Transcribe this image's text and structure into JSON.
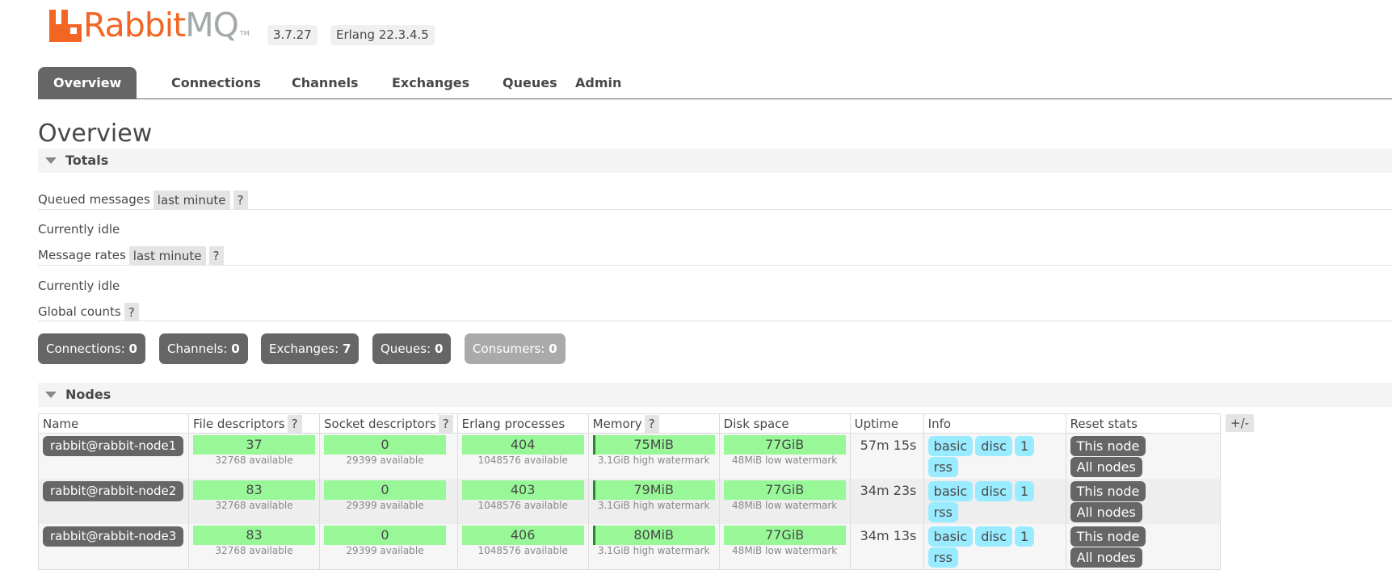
{
  "header": {
    "logo_text_primary": "Rabbit",
    "logo_text_secondary": "MQ",
    "logo_tm": "TM",
    "version": "3.7.27",
    "erlang": "Erlang 22.3.4.5"
  },
  "tabs": [
    {
      "label": "Overview",
      "active": true
    },
    {
      "label": "Connections"
    },
    {
      "label": "Channels"
    },
    {
      "label": "Exchanges"
    },
    {
      "label": "Queues"
    },
    {
      "label": "Admin"
    }
  ],
  "page": {
    "title": "Overview",
    "totals_label": "Totals",
    "queued_messages_label": "Queued messages",
    "queued_range": "last minute",
    "help": "?",
    "queued_status": "Currently idle",
    "message_rates_label": "Message rates",
    "rates_range": "last minute",
    "rates_status": "Currently idle",
    "global_counts_label": "Global counts"
  },
  "counts": [
    {
      "label": "Connections:",
      "value": "0"
    },
    {
      "label": "Channels:",
      "value": "0"
    },
    {
      "label": "Exchanges:",
      "value": "7"
    },
    {
      "label": "Queues:",
      "value": "0"
    },
    {
      "label": "Consumers:",
      "value": "0"
    }
  ],
  "nodes": {
    "section_label": "Nodes",
    "toggle_columns": "+/-",
    "columns": [
      "Name",
      "File descriptors",
      "Socket descriptors",
      "Erlang processes",
      "Memory",
      "Disk space",
      "Uptime",
      "Info",
      "Reset stats"
    ],
    "info_tags": [
      "basic",
      "disc",
      "1",
      "rss"
    ],
    "reset_this": "This node",
    "reset_all": "All nodes",
    "rows": [
      {
        "name": "rabbit@rabbit-node1",
        "fd": "37",
        "fd_avail": "32768 available",
        "sd": "0",
        "sd_avail": "29399 available",
        "ep": "404",
        "ep_avail": "1048576 available",
        "mem": "75MiB",
        "mem_wm": "3.1GiB high watermark",
        "disk": "77GiB",
        "disk_wm": "48MiB low watermark",
        "uptime": "57m 15s"
      },
      {
        "name": "rabbit@rabbit-node2",
        "fd": "83",
        "fd_avail": "32768 available",
        "sd": "0",
        "sd_avail": "29399 available",
        "ep": "403",
        "ep_avail": "1048576 available",
        "mem": "79MiB",
        "mem_wm": "3.1GiB high watermark",
        "disk": "77GiB",
        "disk_wm": "48MiB low watermark",
        "uptime": "34m 23s"
      },
      {
        "name": "rabbit@rabbit-node3",
        "fd": "83",
        "fd_avail": "32768 available",
        "sd": "0",
        "sd_avail": "29399 available",
        "ep": "406",
        "ep_avail": "1048576 available",
        "mem": "80MiB",
        "mem_wm": "3.1GiB high watermark",
        "disk": "77GiB",
        "disk_wm": "48MiB low watermark",
        "uptime": "34m 13s"
      }
    ]
  },
  "colors": {
    "brand_orange": "#f26522",
    "brand_grey": "#a3a9ab",
    "tab_active": "#666666",
    "bar_green": "#98f898",
    "info_blue": "#99ebff",
    "button_grey": "#666666"
  }
}
